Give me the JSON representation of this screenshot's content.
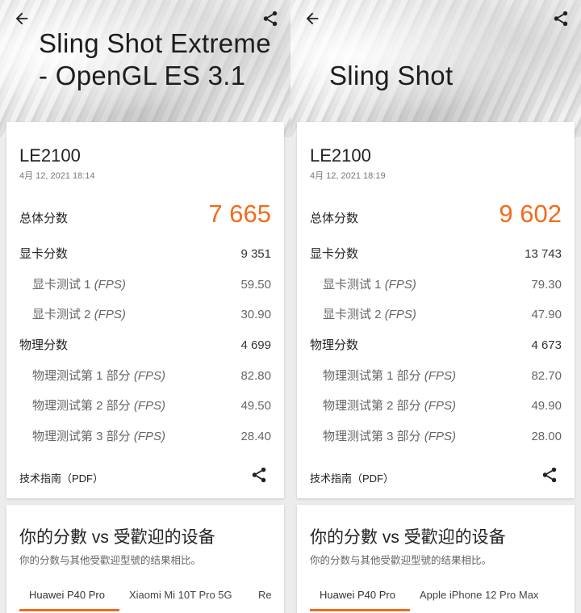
{
  "colors": {
    "accent": "#f26b1d"
  },
  "icons": {
    "back": "arrow-left-icon",
    "share": "share-icon"
  },
  "panels": [
    {
      "hero_title": "Sling Shot Extreme - OpenGL ES 3.1",
      "device": "LE2100",
      "date": "4月 12, 2021 18:14",
      "total_label": "总体分数",
      "total_value": "7 665",
      "gpu_label": "显卡分数",
      "gpu_value": "9 351",
      "gpu_test1_label": "显卡测试 1",
      "gpu_test1_value": "59.50",
      "gpu_test2_label": "显卡测试 2",
      "gpu_test2_value": "30.90",
      "phys_label": "物理分数",
      "phys_value": "4 699",
      "phys_test1_label": "物理测试第 1 部分",
      "phys_test1_value": "82.80",
      "phys_test2_label": "物理测试第 2 部分",
      "phys_test2_value": "49.50",
      "phys_test3_label": "物理测试第 3 部分",
      "phys_test3_value": "28.40",
      "fps_unit": "(FPS)",
      "guide_label": "技术指南（PDF）",
      "compare_title": "你的分數 vs 受歡迎的设备",
      "compare_subtitle": "你的分数与其他受歡迎型號的结果相比。",
      "tabs": [
        "Huawei P40 Pro",
        "Xiaomi Mi 10T Pro 5G",
        "Re"
      ]
    },
    {
      "hero_title": "Sling Shot",
      "device": "LE2100",
      "date": "4月 12, 2021 18:19",
      "total_label": "总体分数",
      "total_value": "9 602",
      "gpu_label": "显卡分数",
      "gpu_value": "13 743",
      "gpu_test1_label": "显卡测试 1",
      "gpu_test1_value": "79.30",
      "gpu_test2_label": "显卡测试 2",
      "gpu_test2_value": "47.90",
      "phys_label": "物理分数",
      "phys_value": "4 673",
      "phys_test1_label": "物理测试第 1 部分",
      "phys_test1_value": "82.70",
      "phys_test2_label": "物理测试第 2 部分",
      "phys_test2_value": "49.90",
      "phys_test3_label": "物理测试第 3 部分",
      "phys_test3_value": "28.00",
      "fps_unit": "(FPS)",
      "guide_label": "技术指南（PDF）",
      "compare_title": "你的分數 vs 受歡迎的设备",
      "compare_subtitle": "你的分数与其他受歡迎型號的结果相比。",
      "tabs": [
        "Huawei P40 Pro",
        "Apple iPhone 12 Pro Max"
      ]
    }
  ]
}
